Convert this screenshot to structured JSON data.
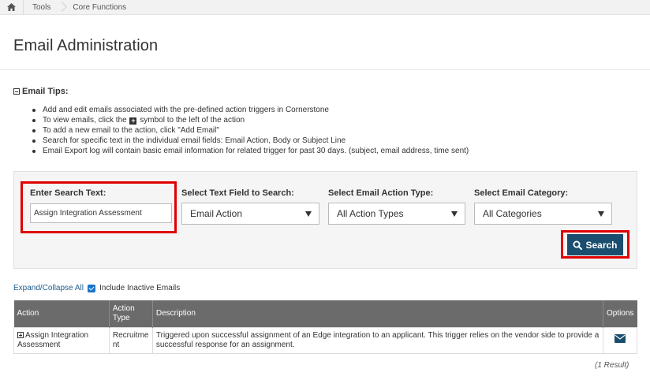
{
  "breadcrumb": {
    "home_icon": "home-icon",
    "items": [
      "Tools",
      "Core Functions"
    ]
  },
  "page": {
    "title": "Email Administration"
  },
  "tips": {
    "header": "Email Tips:",
    "items": [
      "Add and edit emails associated with the pre-defined action triggers in Cornerstone",
      "To view emails, click the",
      "symbol to the left of the action",
      "To add a new email to the action, click \"Add Email\"",
      "Search for specific text in the individual email fields: Email Action, Body or Subject Line",
      "Email Export log will contain basic email information for related trigger for past 30 days. (subject, email address, time sent)"
    ]
  },
  "search": {
    "text_label": "Enter Search Text:",
    "text_value": "Assign Integration Assessment",
    "field_label": "Select Text Field to Search:",
    "field_value": "Email Action",
    "action_type_label": "Select Email Action Type:",
    "action_type_value": "All Action Types",
    "category_label": "Select Email Category:",
    "category_value": "All Categories",
    "button_label": "Search"
  },
  "list_controls": {
    "expand_collapse": "Expand/Collapse All",
    "include_inactive": "Include Inactive Emails",
    "include_inactive_checked": true
  },
  "table": {
    "headers": {
      "action": "Action",
      "action_type_1": "Action",
      "action_type_2": "Type",
      "description": "Description",
      "options": "Options"
    },
    "rows": [
      {
        "action_line1": "Assign Integration",
        "action_line2": "Assessment",
        "type_line1": "Recruitme",
        "type_line2": "nt",
        "description": "Triggered upon successful assignment of an Edge integration to an applicant. This trigger relies on the vendor side to provide a successful response for an assignment."
      }
    ],
    "result_count": "(1 Result)"
  },
  "colors": {
    "search_button": "#1b4e6e",
    "highlight": "#e00000",
    "table_header": "#6b6b6b",
    "link": "#1f5d8e"
  }
}
